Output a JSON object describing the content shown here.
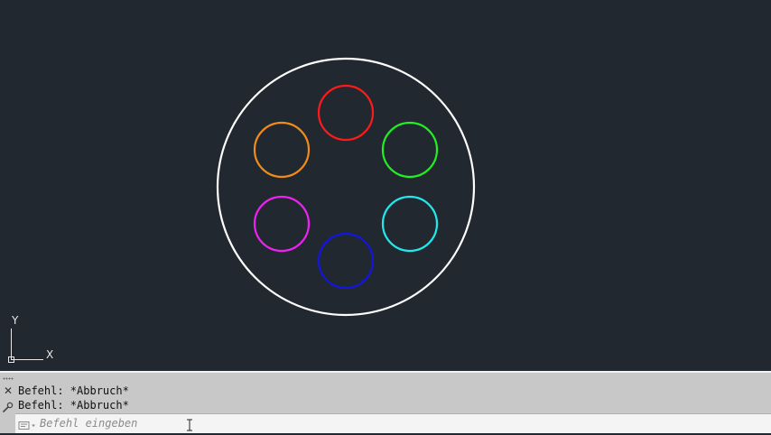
{
  "drawing": {
    "circles": [
      {
        "name": "outer-circle",
        "color": "#ffffff"
      },
      {
        "name": "red-circle",
        "color": "#ff1a1a"
      },
      {
        "name": "green-circle",
        "color": "#22ee22"
      },
      {
        "name": "cyan-circle",
        "color": "#22e8ee"
      },
      {
        "name": "blue-circle",
        "color": "#1515e0"
      },
      {
        "name": "magenta-circle",
        "color": "#ee22ee"
      },
      {
        "name": "orange-circle",
        "color": "#f08c1a"
      }
    ]
  },
  "ucs": {
    "x_label": "X",
    "y_label": "Y"
  },
  "command_line": {
    "history": [
      "Befehl: *Abbruch*",
      "Befehl: *Abbruch*"
    ],
    "input_placeholder": "Befehl eingeben",
    "input_value": ""
  },
  "colors": {
    "background": "#212830",
    "panel": "#c8c8c8",
    "input_bg": "#f4f4f4"
  },
  "icons": {
    "close": "close-icon",
    "options": "wrench-icon",
    "prompt": "command-prompt-icon",
    "cursor": "text-cursor-icon"
  }
}
